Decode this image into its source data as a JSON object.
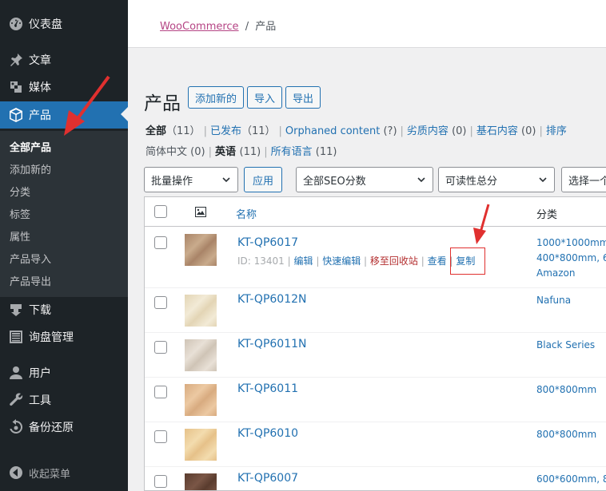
{
  "sidebar": {
    "items": [
      {
        "label": "仪表盘",
        "icon": "dashboard-icon"
      },
      {
        "label": "文章",
        "icon": "pin-icon"
      },
      {
        "label": "媒体",
        "icon": "media-icon"
      },
      {
        "label": "产品",
        "icon": "box-icon"
      },
      {
        "label": "下载",
        "icon": "download-icon"
      },
      {
        "label": "询盘管理",
        "icon": "list-icon"
      },
      {
        "label": "用户",
        "icon": "user-icon"
      },
      {
        "label": "工具",
        "icon": "wrench-icon"
      },
      {
        "label": "备份还原",
        "icon": "backup-icon"
      }
    ],
    "submenu": [
      "全部产品",
      "添加新的",
      "分类",
      "标签",
      "属性",
      "产品导入",
      "产品导出"
    ],
    "collapse_label": "收起菜单"
  },
  "breadcrumb": {
    "link": "WooCommerce",
    "separator": "/",
    "current": "产品"
  },
  "header": {
    "title": "产品",
    "buttons": [
      "添加新的",
      "导入",
      "导出"
    ]
  },
  "filters": {
    "all": "全部",
    "all_count": "（11）",
    "published": "已发布",
    "published_count": "（11）",
    "orphaned": "Orphaned content",
    "orphaned_count": "(?)",
    "poor": "劣质内容",
    "poor_count": "(0)",
    "cornerstone": "基石内容",
    "cornerstone_count": "(0)",
    "sort": "排序",
    "lang_zh": "简体中文",
    "lang_zh_count": "(0)",
    "lang_en": "英语",
    "lang_en_count": "(11)",
    "lang_all": "所有语言",
    "lang_all_count": "(11)"
  },
  "toolbar": {
    "bulk": "批量操作",
    "apply": "应用",
    "seo": "全部SEO分数",
    "readability": "可读性总分",
    "select_type": "选择一个类型"
  },
  "table": {
    "col_name": "名称",
    "col_category": "分类",
    "rows": [
      {
        "name": "KT-QP6017",
        "id": "ID: 13401",
        "actions": [
          "编辑",
          "快速编辑",
          "移至回收站",
          "查看",
          "复制"
        ],
        "category": [
          "1000*1000mm,",
          "400*800mm, 60",
          "Amazon"
        ],
        "color_a": "#a98468",
        "color_b": "#c9ab8c"
      },
      {
        "name": "KT-QP6012N",
        "category": [
          "Nafuna"
        ],
        "color_a": "#e3d5b5",
        "color_b": "#f2ead6"
      },
      {
        "name": "KT-QP6011N",
        "category": [
          "Black Series"
        ],
        "color_a": "#cfc4b6",
        "color_b": "#e8e0d6"
      },
      {
        "name": "KT-QP6011",
        "category": [
          "800*800mm"
        ],
        "color_a": "#d8ab80",
        "color_b": "#ecc9a2"
      },
      {
        "name": "KT-QP6010",
        "category": [
          "800*800mm"
        ],
        "color_a": "#e6c189",
        "color_b": "#f3dcae"
      },
      {
        "name": "KT-QP6007",
        "category": [
          "600*600mm, 8"
        ],
        "color_a": "#5a3c2e",
        "color_b": "#7a5646"
      }
    ]
  },
  "colors": {
    "accent": "#2271b1",
    "sidebar": "#1d2327",
    "annotation": "#e0302f"
  }
}
